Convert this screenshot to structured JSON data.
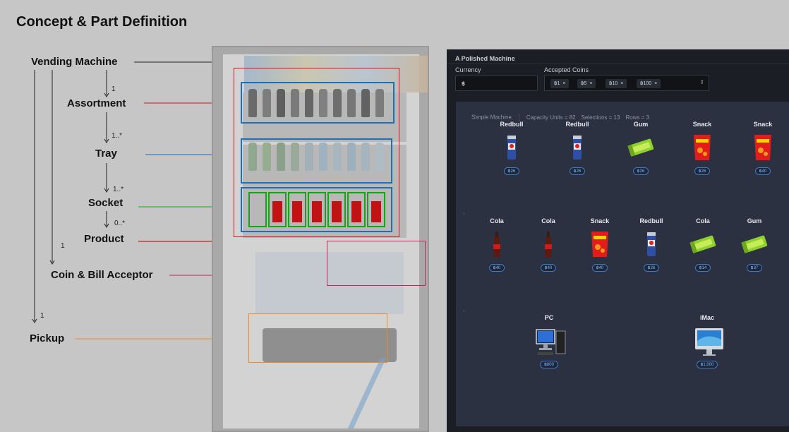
{
  "page": {
    "title": "Concept & Part Definition"
  },
  "concepts": {
    "vending_machine": "Vending Machine",
    "assortment": "Assortment",
    "tray": "Tray",
    "socket": "Socket",
    "product": "Product",
    "coin_acceptor": "Coin & Bill Acceptor",
    "pickup": "Pickup"
  },
  "multiplicities": {
    "assortment": "1",
    "tray": "1..*",
    "socket": "1..*",
    "product": "0..*",
    "coin_acceptor": "1",
    "pickup": "1"
  },
  "colors": {
    "vending_machine": "#222222",
    "assortment": "#d0141e",
    "tray": "#1f6fb5",
    "socket": "#1aa31a",
    "product": "#b00000",
    "coin_acceptor": "#c0245a",
    "pickup": "#f08a24"
  },
  "app": {
    "title": "A Polished Machine",
    "currency_label": "Currency",
    "currency_value": "฿",
    "coins_label": "Accepted Coins",
    "coins": [
      "฿1",
      "฿5",
      "฿10",
      "฿100"
    ],
    "stats": {
      "name": "Simple Machine",
      "capacity": "Capacity Units = 82",
      "selections": "Selections = 13",
      "rows": "Rows = 3"
    },
    "rows": [
      [
        {
          "name": "Redbull",
          "price": "฿26",
          "icon": "redbull-can"
        },
        {
          "name": "Redbull",
          "price": "฿26",
          "icon": "redbull-can"
        },
        {
          "name": "Gum",
          "price": "฿26",
          "icon": "gum-pack"
        },
        {
          "name": "Snack",
          "price": "฿26",
          "icon": "snack-bag"
        },
        {
          "name": "Snack",
          "price": "฿40",
          "icon": "snack-bag"
        }
      ],
      [
        {
          "name": "Cola",
          "price": "฿40",
          "icon": "cola-bottle"
        },
        {
          "name": "Cola",
          "price": "฿40",
          "icon": "cola-bottle"
        },
        {
          "name": "Snack",
          "price": "฿40",
          "icon": "snack-bag"
        },
        {
          "name": "Redbull",
          "price": "฿26",
          "icon": "redbull-can"
        },
        {
          "name": "Cola",
          "price": "฿14",
          "icon": "gum-pack"
        },
        {
          "name": "Gum",
          "price": "฿37",
          "icon": "gum-pack"
        }
      ],
      [
        {
          "name": "PC",
          "price": "฿800",
          "icon": "pc-computer"
        },
        {
          "name": "iMac",
          "price": "฿1,000",
          "icon": "imac-computer"
        }
      ]
    ]
  }
}
